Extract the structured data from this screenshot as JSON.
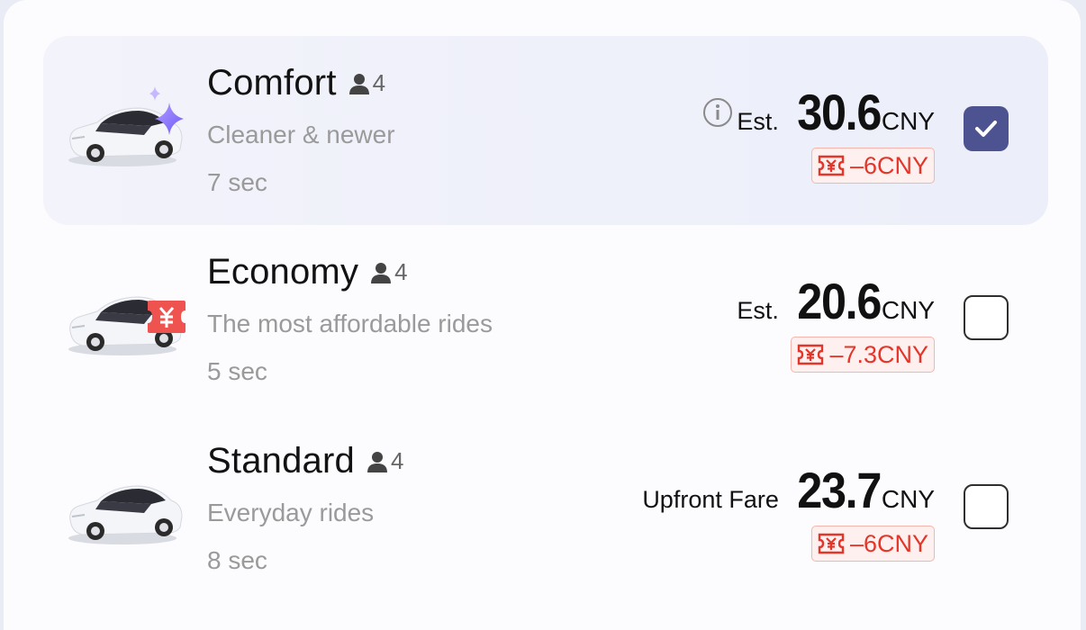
{
  "rides": [
    {
      "name": "Comfort",
      "seats": "4",
      "description": "Cleaner & newer",
      "eta": "7 sec",
      "price_label": "Est.",
      "price": "30.6",
      "currency": "CNY",
      "discount": "–6CNY",
      "selected": true,
      "badge": "sparkle-icon"
    },
    {
      "name": "Economy",
      "seats": "4",
      "description": "The most affordable rides",
      "eta": "5 sec",
      "price_label": "Est.",
      "price": "20.6",
      "currency": "CNY",
      "discount": "–7.3CNY",
      "selected": false,
      "badge": "yen-tag-icon"
    },
    {
      "name": "Standard",
      "seats": "4",
      "description": "Everyday rides",
      "eta": "8 sec",
      "price_label": "Upfront Fare",
      "price": "23.7",
      "currency": "CNY",
      "discount": "–6CNY",
      "selected": false,
      "badge": ""
    }
  ],
  "colors": {
    "accent": "#4d5390",
    "discount_red": "#e4352a",
    "selected_row": "#eef0fa"
  }
}
